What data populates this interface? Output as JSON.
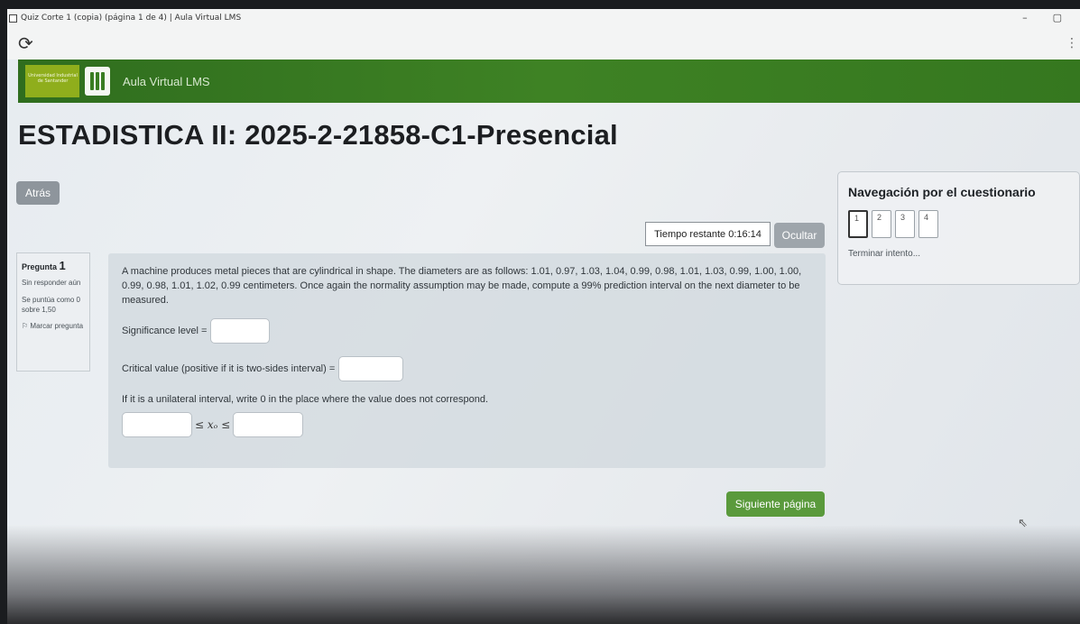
{
  "window": {
    "title": "Quiz Corte 1 (copia) (página 1 de 4) | Aula Virtual LMS",
    "minimize": "–",
    "restore": "▢"
  },
  "toolbar": {
    "reload_icon": "⟳",
    "menu_icon": "⋮"
  },
  "header": {
    "logo_text": "Universidad Industrial de Santander",
    "brand": "Aula Virtual LMS"
  },
  "page": {
    "title": "ESTADISTICA II: 2025-2-21858-C1-Presencial",
    "back_label": "Atrás"
  },
  "timer": {
    "label": "Tiempo restante 0:16:14",
    "hide_label": "Ocultar"
  },
  "question_info": {
    "label": "Pregunta",
    "number": "1",
    "status": "Sin responder aún",
    "grade": "Se puntúa como 0 sobre 1,50",
    "flag": "Marcar pregunta"
  },
  "question": {
    "text": "A machine produces metal pieces that are cylindrical in shape. The diameters are as follows: 1.01, 0.97, 1.03, 1.04, 0.99, 0.98, 1.01, 1.03, 0.99, 1.00, 1.00, 0.99, 0.98, 1.01, 1.02, 0.99 centimeters. Once again the normality assumption may be made, compute a 99% prediction interval on the next diameter to be measured.",
    "significance_label": "Significance level =",
    "critical_label": "Critical value (positive if it is two-sides interval) =",
    "unilateral_note": "If it is a unilateral interval, write 0 in the place where the value does not correspond.",
    "interval_symbol": "≤ xₒ ≤",
    "significance_value": "",
    "critical_value": "",
    "lower_value": "",
    "upper_value": ""
  },
  "navigation": {
    "title": "Navegación por el cuestionario",
    "pages": [
      "1",
      "2",
      "3",
      "4"
    ],
    "finish_label": "Terminar intento..."
  },
  "footer": {
    "next_label": "Siguiente página"
  }
}
